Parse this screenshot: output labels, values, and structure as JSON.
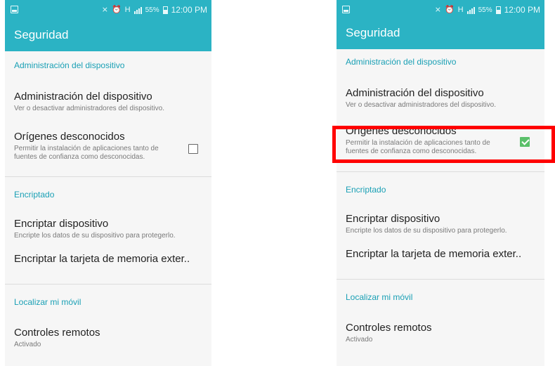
{
  "left": {
    "status": {
      "time": "12:00 PM",
      "battery": "55%"
    },
    "app_title": "Seguridad",
    "sections": {
      "device_admin_header": "Administración del dispositivo",
      "device_admin": {
        "title": "Administración del dispositivo",
        "summary": "Ver o desactivar administradores del dispositivo."
      },
      "unknown_sources": {
        "title": "Orígenes desconocidos",
        "summary_line1": "Permitir la instalación de aplicaciones tanto de",
        "summary_line2": "fuentes de confianza como desconocidas.",
        "checked": false
      },
      "encryption_header": "Encriptado",
      "encrypt_device": {
        "title": "Encriptar dispositivo",
        "summary": "Encripte los datos de su dispositivo para protegerlo."
      },
      "encrypt_sd": {
        "title": "Encriptar la tarjeta de memoria exter.."
      },
      "find_mobile_header": "Localizar mi móvil",
      "remote_controls": {
        "title": "Controles remotos",
        "summary": "Activado"
      }
    }
  },
  "right": {
    "status": {
      "time": "12:00 PM",
      "battery": "55%"
    },
    "app_title": "Seguridad",
    "sections": {
      "device_admin_header": "Administración del dispositivo",
      "device_admin": {
        "title": "Administración del dispositivo",
        "summary": "Ver o desactivar administradores del dispositivo."
      },
      "unknown_sources": {
        "title": "Orígenes desconocidos",
        "summary_line1": "Permitir la instalación de aplicaciones tanto de",
        "summary_line2": "fuentes de confianza como desconocidas.",
        "checked": true
      },
      "encryption_header": "Encriptado",
      "encrypt_device": {
        "title": "Encriptar dispositivo",
        "summary": "Encripte los datos de su dispositivo para protegerlo."
      },
      "encrypt_sd": {
        "title": "Encriptar la tarjeta de memoria exter.."
      },
      "find_mobile_header": "Localizar mi móvil",
      "remote_controls": {
        "title": "Controles remotos",
        "summary": "Activado"
      }
    }
  },
  "colors": {
    "accent": "#2bb3c4",
    "section_header": "#1aa0b5",
    "checkbox_checked": "#5bc06a",
    "highlight": "#ff0000"
  },
  "icons": [
    "notification-icon",
    "mute-icon",
    "alarm-icon",
    "h-network-icon",
    "signal-icon",
    "battery-icon"
  ]
}
